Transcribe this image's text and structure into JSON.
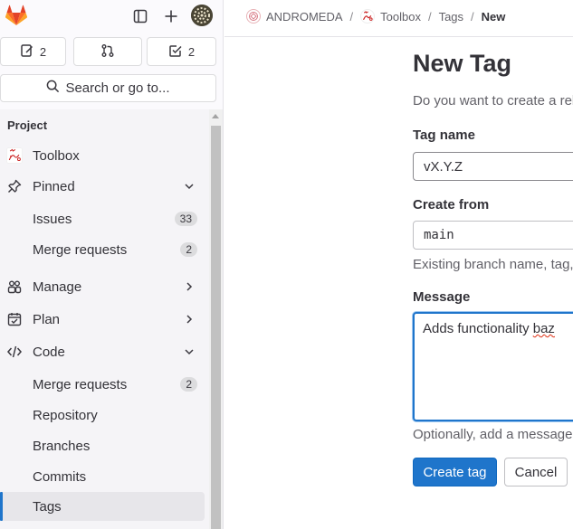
{
  "sidebar": {
    "counters": [
      {
        "icon": "issues-icon",
        "count": "2"
      },
      {
        "icon": "merge-request-icon",
        "count": ""
      },
      {
        "icon": "todo-icon",
        "count": "2"
      }
    ],
    "search_label": "Search or go to...",
    "section_heading": "Project",
    "project_name": "Toolbox",
    "items": [
      {
        "label": "Pinned",
        "icon": "pin-icon"
      },
      {
        "label": "Issues",
        "badge": "33"
      },
      {
        "label": "Merge requests",
        "badge": "2"
      },
      {
        "label": "Manage",
        "icon": "users-icon"
      },
      {
        "label": "Plan",
        "icon": "planning-icon"
      },
      {
        "label": "Code",
        "icon": "code-icon"
      },
      {
        "label": "Merge requests",
        "badge": "2"
      },
      {
        "label": "Repository"
      },
      {
        "label": "Branches"
      },
      {
        "label": "Commits"
      },
      {
        "label": "Tags"
      }
    ]
  },
  "breadcrumbs": {
    "group": "ANDROMEDA",
    "project": "Toolbox",
    "section": "Tags",
    "current": "New"
  },
  "form": {
    "title": "New Tag",
    "description": "Do you want to create a release with the new tag? You can do that in the New release page.",
    "tag_name_label": "Tag name",
    "tag_name_value": "vX.Y.Z",
    "create_from_label": "Create from",
    "create_from_value": "main",
    "create_from_hint": "Existing branch name, tag, or commit SHA",
    "message_label": "Message",
    "message_value_prefix": "Adds functionality ",
    "message_value_misspelled": "baz",
    "message_hint": "Optionally, add a message to the tag. Leaving this blank creates a lightweight tag.",
    "create_button": "Create tag",
    "cancel_button": "Cancel"
  },
  "colors": {
    "accent": "#1f75cb",
    "logo_orange": "#e24329",
    "active_bar": "#1f75cb"
  }
}
